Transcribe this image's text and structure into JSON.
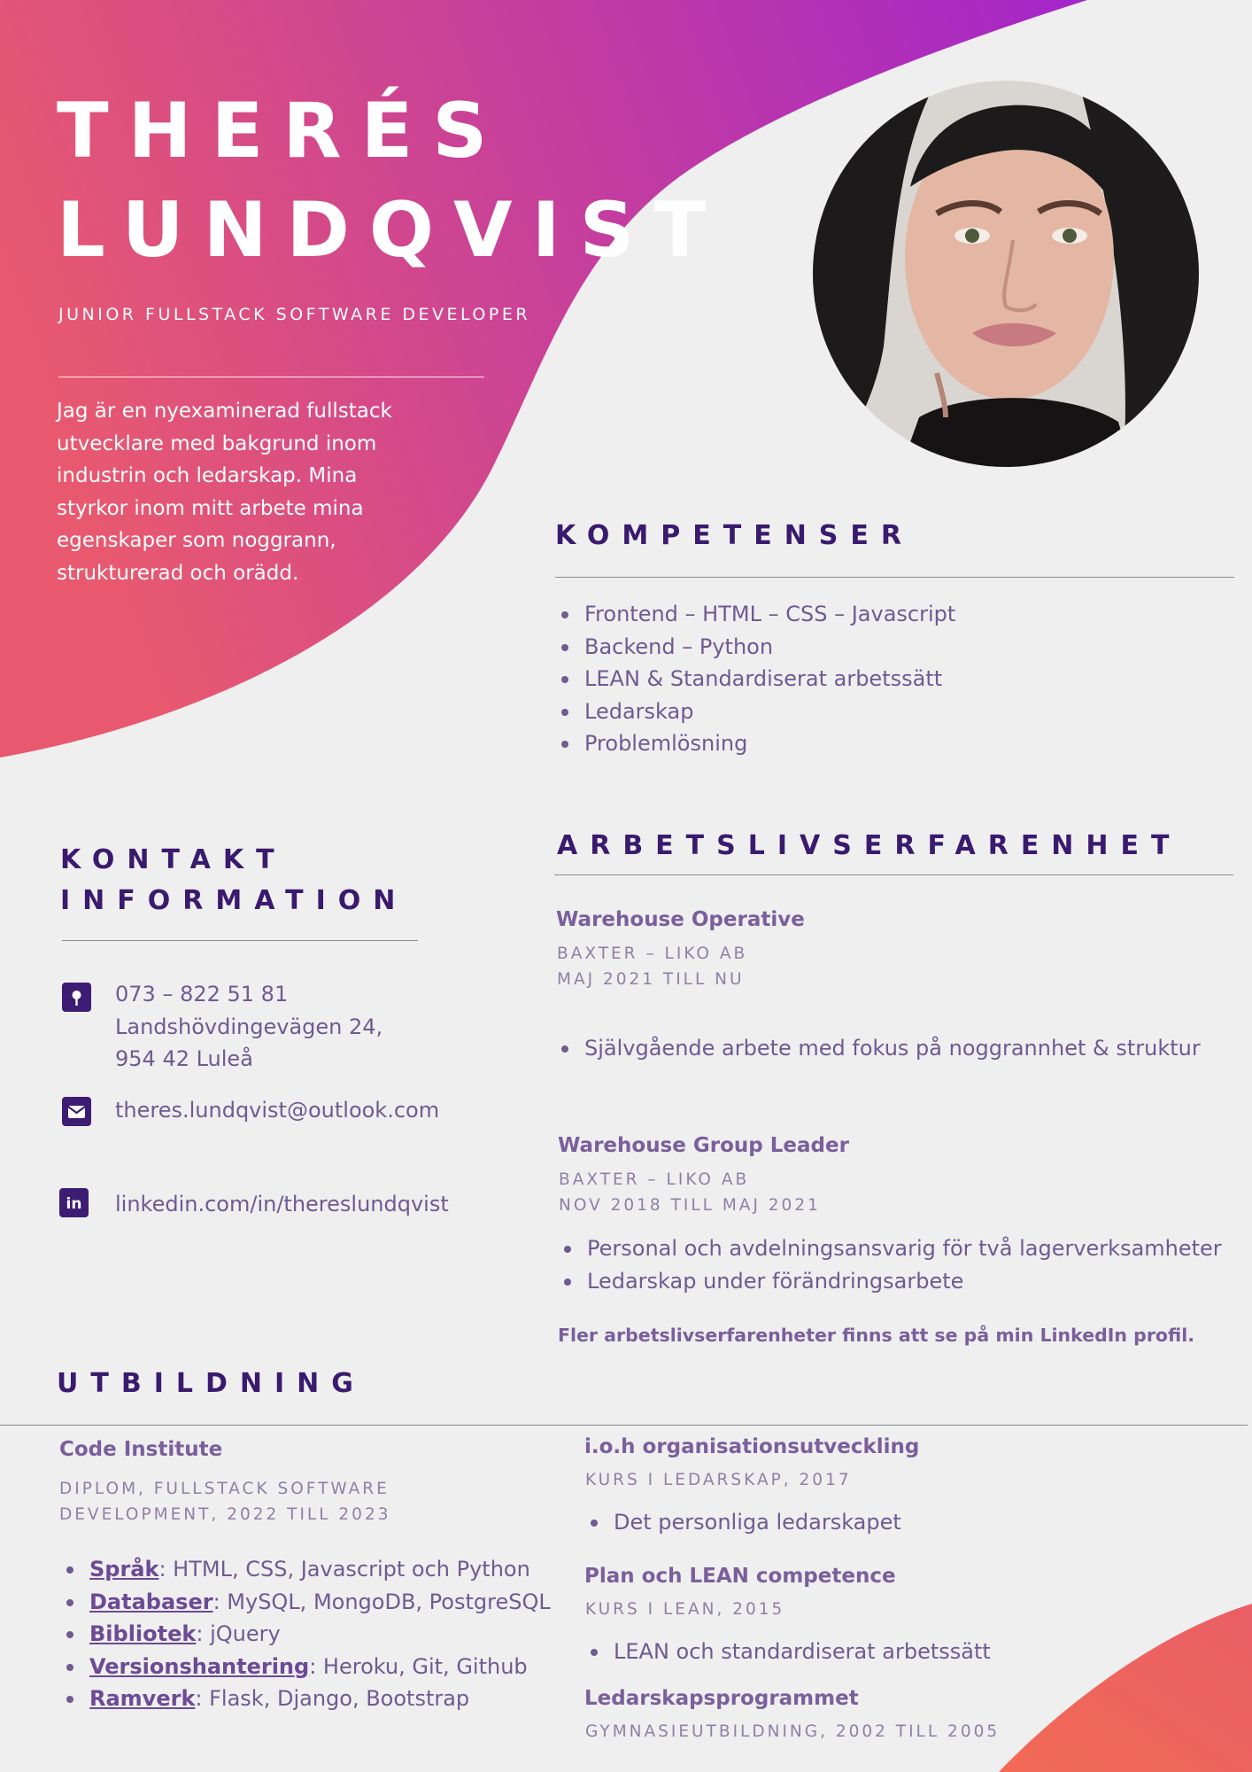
{
  "colors": {
    "accent": "#3a1a6e",
    "text": "#6f5a92",
    "gradient_start": "#e8596f",
    "gradient_end": "#a526c8",
    "corner": "#f26a55"
  },
  "header": {
    "first_name": "THERÉS",
    "last_name": "LUNDQVIST",
    "title": "JUNIOR FULLSTACK SOFTWARE DEVELOPER",
    "intro": "Jag är en nyexaminerad fullstack utvecklare med bakgrund inom industrin och ledarskap. Mina styrkor inom mitt arbete mina egenskaper som noggrann, strukturerad och orädd."
  },
  "skills": {
    "heading": "KOMPETENSER",
    "items": [
      "Frontend – HTML – CSS – Javascript",
      "Backend – Python",
      "LEAN & Standardiserat arbetssätt",
      "Ledarskap",
      "Problemlösning"
    ]
  },
  "contact": {
    "heading_line1": "KONTAKT",
    "heading_line2": "INFORMATION",
    "phone": "073 – 822 51 81",
    "address_line1": "Landshövdingevägen 24,",
    "address_line2": "954 42 Luleå",
    "email": "theres.lundqvist@outlook.com",
    "linkedin": "linkedin.com/in/thereslundqvist",
    "icons": [
      "location-pin-icon",
      "email-icon",
      "linkedin-icon"
    ]
  },
  "experience": {
    "heading": "ARBETSLIVSERFARENHET",
    "jobs": [
      {
        "title": "Warehouse Operative",
        "company": "BAXTER – LIKO AB",
        "period": "MAJ 2021 TILL NU",
        "bullets": [
          "Självgående arbete med fokus på noggrannhet & struktur"
        ]
      },
      {
        "title": "Warehouse Group Leader",
        "company": "BAXTER – LIKO AB",
        "period": "NOV 2018 TILL MAJ 2021",
        "bullets": [
          "Personal och avdelningsansvarig för två lagerverksamheter",
          "Ledarskap under förändringsarbete"
        ]
      }
    ],
    "note": "Fler arbetslivserfarenheter finns att se på min LinkedIn profil."
  },
  "education": {
    "heading": "UTBILDNING",
    "main": {
      "school": "Code Institute",
      "degree_line1": "DIPLOM, FULLSTACK SOFTWARE",
      "degree_line2": "DEVELOPMENT, 2022 TILL 2023",
      "items": [
        {
          "key": "Språk",
          "value": ": HTML, CSS, Javascript och Python"
        },
        {
          "key": "Databaser",
          "value": ": MySQL, MongoDB, PostgreSQL"
        },
        {
          "key": "Bibliotek",
          "value": ": jQuery"
        },
        {
          "key": "Versionshantering",
          "value": ": Heroku, Git, Github"
        },
        {
          "key": "Ramverk",
          "value": ": Flask, Django, Bootstrap"
        }
      ]
    },
    "courses": [
      {
        "title": "i.o.h organisationsutveckling",
        "meta": "KURS I LEDARSKAP, 2017",
        "bullet": "Det personliga ledarskapet"
      },
      {
        "title": "Plan och LEAN competence",
        "meta": "KURS I LEAN, 2015",
        "bullet": "LEAN och standardiserat arbetssätt"
      },
      {
        "title": "Ledarskapsprogrammet",
        "meta": "GYMNASIEUTBILDNING, 2002 TILL 2005"
      }
    ]
  }
}
